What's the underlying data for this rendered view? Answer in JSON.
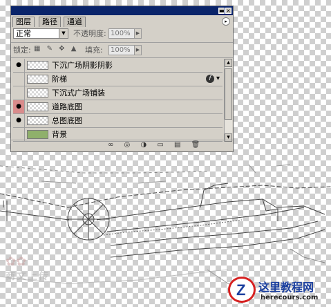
{
  "panel": {
    "tabs": [
      "图层",
      "路径",
      "通道"
    ],
    "blend_mode": "正常",
    "opacity_label": "不透明度:",
    "opacity_value": "100%",
    "lock_label": "锁定:",
    "fill_label": "填充:",
    "fill_value": "100%",
    "layers": [
      {
        "name": "下沉广场阴影阴影",
        "visible": true,
        "thumb": "transparent"
      },
      {
        "name": "阶梯",
        "visible": false,
        "thumb": "transparent",
        "fx": true
      },
      {
        "name": "下沉式广场铺装",
        "visible": false,
        "thumb": "transparent"
      },
      {
        "name": "道路底图",
        "visible": true,
        "highlight": true,
        "thumb": "transparent"
      },
      {
        "name": "总图底图",
        "visible": true,
        "thumb": "transparent"
      },
      {
        "name": "背景",
        "visible": false,
        "thumb": "green"
      }
    ]
  },
  "watermark": {
    "logo_sub": "商文上传"
  },
  "brand": {
    "name": "这里教程网",
    "url": "herecours.com"
  },
  "colors": {
    "titlebar": "#0a246a",
    "panel_bg": "#d4d0c8",
    "brand_blue": "#1b3f9e",
    "brand_red": "#d62020"
  }
}
